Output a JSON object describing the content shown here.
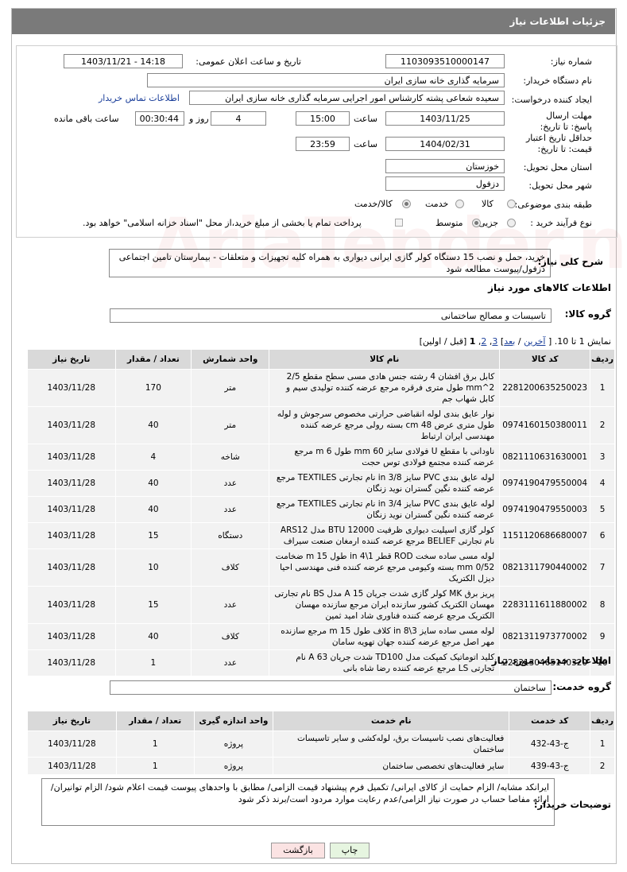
{
  "header": {
    "title": "جزئیات اطلاعات نیاز"
  },
  "form": {
    "need_number_label": "شماره نیاز:",
    "need_number": "1103093510000147",
    "announce_label": "تاریخ و ساعت اعلان عمومی:",
    "announce_value": "1403/11/21 - 14:18",
    "buyer_org_label": "نام دستگاه خریدار:",
    "buyer_org": "سرمایه گذاری خانه سازی ایران",
    "requester_label": "ایجاد کننده درخواست:",
    "requester": "سعیده شعاعی پشته کارشناس امور اجرایی سرمایه گذاری خانه سازی ایران",
    "contact_link": "اطلاعات تماس خریدار",
    "deadline_label": "مهلت ارسال پاسخ: تا تاریخ:",
    "deadline_date": "1403/11/25",
    "time_label": "ساعت",
    "deadline_time": "15:00",
    "days_value": "4",
    "days_label": "روز و",
    "remaining_time": "00:30:44",
    "remaining_label": "ساعت باقی مانده",
    "validity_label": "حداقل تاریخ اعتبار قیمت: تا تاریخ:",
    "validity_date": "1404/02/31",
    "validity_time": "23:59",
    "province_label": "استان محل تحویل:",
    "province": "خوزستان",
    "city_label": "شهر محل تحویل:",
    "city": "دزفول",
    "category_label": "طبقه بندی موضوعی:",
    "category_options": [
      "کالا",
      "خدمت",
      "کالا/خدمت"
    ],
    "category_selected": "کالا/خدمت",
    "process_label": "نوع فرآیند خرید :",
    "process_options": [
      "جزیی",
      "متوسط"
    ],
    "process_selected": "متوسط",
    "payment_note": "پرداخت تمام یا بخشی از مبلغ خرید،از محل \"اسناد خزانه اسلامی\" خواهد بود."
  },
  "description": {
    "label": "شرح کلی نیاز:",
    "text": "خرید، حمل و نصب 15 دستگاه کولر گازی ایرانی دیواری به همراه کلیه تجهیزات و متعلقات - بیمارستان تامین اجتماعی دزفول/پیوست مطالعه شود"
  },
  "goods": {
    "section_title": "اطلاعات کالاهای مورد نیاز",
    "group_label": "گروه کالا:",
    "group_value": "تاسیسات و مصالح ساختمانی",
    "pager_prefix": "نمایش 1 تا 10. [",
    "pager_last": "آخرین",
    "pager_next": "بعد",
    "pager_p3": "3",
    "pager_p2": "2",
    "pager_p1": "1",
    "pager_suffix": "[قبل / اولین]",
    "columns": [
      "ردیف",
      "کد کالا",
      "نام کالا",
      "واحد شمارش",
      "تعداد / مقدار",
      "تاریخ نیاز"
    ],
    "rows": [
      {
        "idx": "1",
        "code": "2281200635250023",
        "name": "کابل برق افشان 4 رشته جنس هادی مسی سطح مقطع 2/5 mm^2 طول متری فرقره مرجع عرضه کننده تولیدی سیم و کابل شهاب جم",
        "unit": "متر",
        "qty": "170",
        "date": "1403/11/28"
      },
      {
        "idx": "2",
        "code": "0974160150380011",
        "name": "نوار عایق بندی لوله انقباضی حرارتی مخصوص سرجوش و لوله طول متری عرض 48 cm بسته رولی مرجع عرضه کننده مهندسی ایران ارتباط",
        "unit": "متر",
        "qty": "40",
        "date": "1403/11/28"
      },
      {
        "idx": "3",
        "code": "0821110631630001",
        "name": "ناودانی با مقطع U فولادی سایز 60 mm طول 6 m مرجع عرضه کننده مجتمع فولادی توس حجت",
        "unit": "شاخه",
        "qty": "4",
        "date": "1403/11/28"
      },
      {
        "idx": "4",
        "code": "0974190479550004",
        "name": "لوله عایق بندی PVC سایز 3/8 in نام تجارتی TEXTILES مرجع عرضه کننده نگین گستران نوید زنگان",
        "unit": "عدد",
        "qty": "40",
        "date": "1403/11/28"
      },
      {
        "idx": "5",
        "code": "0974190479550003",
        "name": "لوله عایق بندی PVC سایز 3/4 in نام تجارتی TEXTILES مرجع عرضه کننده نگین گستران نوید زنگان",
        "unit": "عدد",
        "qty": "40",
        "date": "1403/11/28"
      },
      {
        "idx": "6",
        "code": "1151120686680007",
        "name": "کولر گازی اسپلیت دیواری ظرفیت BTU 12000 مدل ARS12 نام تجارتی BELIEF مرجع عرضه کننده ارمغان صنعت سیراف",
        "unit": "دستگاه",
        "qty": "15",
        "date": "1403/11/28"
      },
      {
        "idx": "7",
        "code": "0821311790440002",
        "name": "لوله مسی ساده سخت ROD قطر 1\\4 in طول 15 m ضخامت 0/52 mm بسته وکیومی مرجع عرضه کننده فنی مهندسی احیا دیزل الکتریک",
        "unit": "کلاف",
        "qty": "10",
        "date": "1403/11/28"
      },
      {
        "idx": "8",
        "code": "2283111611880002",
        "name": "پریز برق MK کولر گازی شدت جریان 15 A مدل BS نام تجارتی مهسان الکتریک کشور سازنده ایران مرجع سازنده مهسان الکتریک مرجع عرضه کننده فناوری شاد امید ثمین",
        "unit": "عدد",
        "qty": "15",
        "date": "1403/11/28"
      },
      {
        "idx": "9",
        "code": "0821311973770002",
        "name": "لوله مسی ساده سایز 3\\8 in کلاف طول 15 m مرجع سازنده مهر اصل مرجع عرضه کننده جهان تهویه سامان",
        "unit": "کلاف",
        "qty": "40",
        "date": "1403/11/28"
      },
      {
        "idx": "10",
        "code": "2283130465140320",
        "name": "کلید اتوماتیک کمپکت مدل TD100 شدت جریان 63 A نام تجارتی LS مرجع عرضه کننده رضا شاه بانی",
        "unit": "عدد",
        "qty": "1",
        "date": "1403/11/28"
      }
    ]
  },
  "services": {
    "section_title": "اطلاعات خدمات مورد نیاز",
    "group_label": "گروه خدمت:",
    "group_value": "ساختمان",
    "columns": [
      "ردیف",
      "کد خدمت",
      "نام خدمت",
      "واحد اندازه گیری",
      "تعداد / مقدار",
      "تاریخ نیاز"
    ],
    "rows": [
      {
        "idx": "1",
        "code": "ج-43-432",
        "name": "فعالیت‌های نصب تاسیسات برق، لوله‌کشی و سایر تاسیسات ساختمان",
        "unit": "پروژه",
        "qty": "1",
        "date": "1403/11/28"
      },
      {
        "idx": "2",
        "code": "ج-43-439",
        "name": "سایر فعالیت‌های تخصصی ساختمان",
        "unit": "پروژه",
        "qty": "1",
        "date": "1403/11/28"
      }
    ]
  },
  "buyer_notes": {
    "label": "توضیحات خریدار:",
    "text": "ایرانکد مشابه/ الزام حمایت از کالای ایرانی/ تکمیل فرم پیشنهاد قیمت الزامی/ مطابق با واحدهای پیوست قیمت اعلام شود/ الزام توانیران/ ارائه مفاصا حساب در صورت نیاز الزامی/عدم رعایت موارد مردود است/برند ذکر شود"
  },
  "buttons": {
    "print": "چاپ",
    "back": "بازگشت"
  },
  "colors": {
    "header_bg": "#7a7a7a",
    "table_header": "#d9d9d9",
    "table_row": "#f2f2f2",
    "print_btn": "#e6f5e0",
    "back_btn": "#fbe3e3"
  }
}
